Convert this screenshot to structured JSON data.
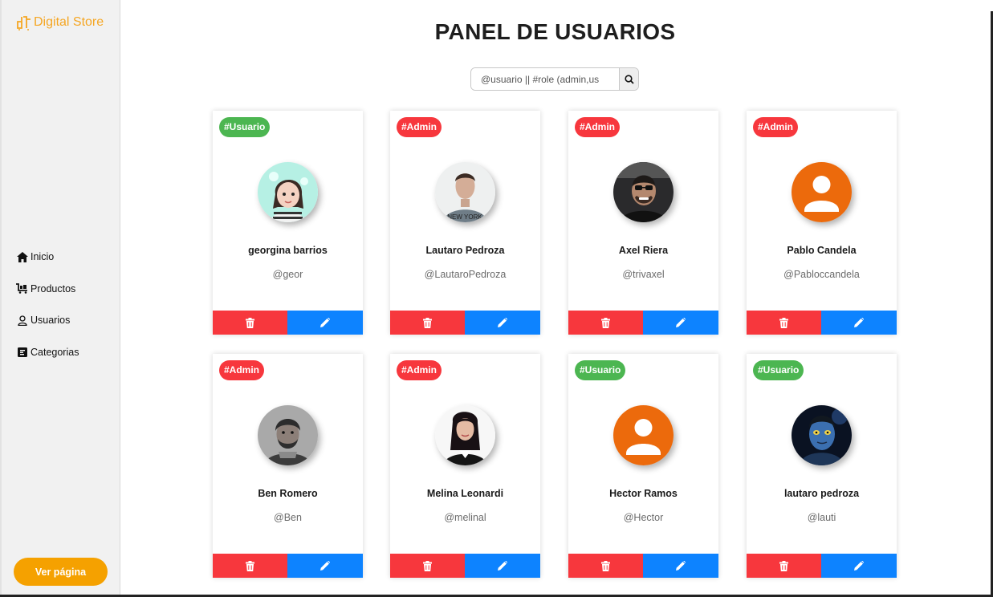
{
  "app": {
    "brand": "Digital Store",
    "accent": "#f5a623"
  },
  "sidebar": {
    "items": [
      {
        "label": "Inicio",
        "icon": "home-icon"
      },
      {
        "label": "Productos",
        "icon": "cart-icon"
      },
      {
        "label": "Usuarios",
        "icon": "user-icon"
      },
      {
        "label": "Categorias",
        "icon": "category-icon"
      }
    ],
    "cta_label": "Ver página"
  },
  "main": {
    "title": "PANEL DE USUARIOS",
    "search": {
      "placeholder": "@usuario || #role (admin,us",
      "value": ""
    }
  },
  "colors": {
    "usuario": "#4cb651",
    "admin": "#f7373d",
    "delete": "#f7373d",
    "edit": "#0d83ff"
  },
  "users": [
    {
      "role": "#Usuario",
      "name": "georgina barrios",
      "handle": "@geor",
      "avatar": "avatar-cartoon"
    },
    {
      "role": "#Admin",
      "name": "Lautaro Pedroza",
      "handle": "@LautaroPedroza",
      "avatar": "avatar-photo"
    },
    {
      "role": "#Admin",
      "name": "Axel Riera",
      "handle": "@trivaxel",
      "avatar": "avatar-photo"
    },
    {
      "role": "#Admin",
      "name": "Pablo Candela",
      "handle": "@Pabloccandela",
      "avatar": "avatar-default"
    },
    {
      "role": "#Admin",
      "name": "Ben Romero",
      "handle": "@Ben",
      "avatar": "avatar-photo"
    },
    {
      "role": "#Admin",
      "name": "Melina Leonardi",
      "handle": "@melinal",
      "avatar": "avatar-photo"
    },
    {
      "role": "#Usuario",
      "name": "Hector Ramos",
      "handle": "@Hector",
      "avatar": "avatar-default"
    },
    {
      "role": "#Usuario",
      "name": "lautaro pedroza",
      "handle": "@lauti",
      "avatar": "avatar-photo"
    }
  ]
}
